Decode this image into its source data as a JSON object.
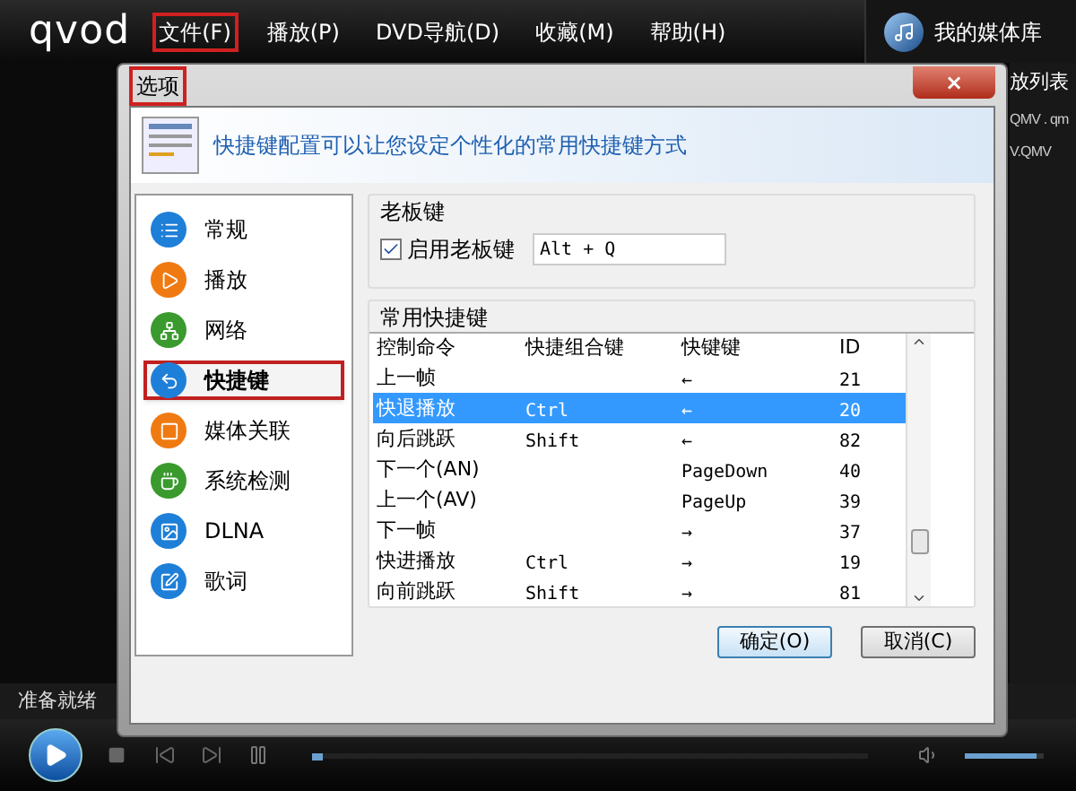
{
  "app": {
    "logo": "qvod",
    "library_button": "我的媒体库"
  },
  "menu": [
    {
      "label": "文件(F)",
      "highlighted": true
    },
    {
      "label": "播放(P)",
      "highlighted": false
    },
    {
      "label": "DVD导航(D)",
      "highlighted": false
    },
    {
      "label": "收藏(M)",
      "highlighted": false
    },
    {
      "label": "帮助(H)",
      "highlighted": false
    }
  ],
  "playlist": {
    "title": "放列表",
    "items": [
      "QMV . qm",
      "V.QMV"
    ]
  },
  "status": "准备就绪",
  "player": {
    "progress": {
      "level": 0.02
    },
    "volume": {
      "level": 0.9
    }
  },
  "dialog": {
    "title": "选项",
    "title_highlighted": true,
    "close": "×",
    "header": "快捷键配置可以让您设定个性化的常用快捷键方式",
    "nav": [
      {
        "label": "常规",
        "color": "#1e7fd8",
        "selected": false,
        "highlighted": false
      },
      {
        "label": "播放",
        "color": "#f07a12",
        "selected": false,
        "highlighted": false
      },
      {
        "label": "网络",
        "color": "#3a9a2e",
        "selected": false,
        "highlighted": false
      },
      {
        "label": "快捷键",
        "color": "#1e7fd8",
        "selected": true,
        "highlighted": true
      },
      {
        "label": "媒体关联",
        "color": "#f07a12",
        "selected": false,
        "highlighted": false
      },
      {
        "label": "系统检测",
        "color": "#3a9a2e",
        "selected": false,
        "highlighted": false
      },
      {
        "label": "DLNA",
        "color": "#1e7fd8",
        "selected": false,
        "highlighted": false
      },
      {
        "label": "歌词",
        "color": "#1e7fd8",
        "selected": false,
        "highlighted": false
      }
    ],
    "boss_key": {
      "title": "老板键",
      "checkbox": {
        "label": "启用老板键",
        "checked": true
      },
      "value": "Alt + Q"
    },
    "shortcuts": {
      "title": "常用快捷键",
      "columns": [
        "控制命令",
        "快捷组合键",
        "快键键",
        "ID"
      ],
      "rows": [
        {
          "cells": [
            "上一帧",
            "",
            "←",
            "21"
          ],
          "selected": false
        },
        {
          "cells": [
            "快退播放",
            "Ctrl",
            "←",
            "20"
          ],
          "selected": true
        },
        {
          "cells": [
            "向后跳跃",
            "Shift",
            "←",
            "82"
          ],
          "selected": false
        },
        {
          "cells": [
            "下一个(AN)",
            "",
            "PageDown",
            "40"
          ],
          "selected": false
        },
        {
          "cells": [
            "上一个(AV)",
            "",
            "PageUp",
            "39"
          ],
          "selected": false
        },
        {
          "cells": [
            "下一帧",
            "",
            "→",
            "37"
          ],
          "selected": false
        },
        {
          "cells": [
            "快进播放",
            "Ctrl",
            "→",
            "19"
          ],
          "selected": false
        },
        {
          "cells": [
            "向前跳跃",
            "Shift",
            "→",
            "81"
          ],
          "selected": false
        }
      ]
    },
    "buttons": [
      "确定(O)",
      "取消(C)"
    ]
  }
}
